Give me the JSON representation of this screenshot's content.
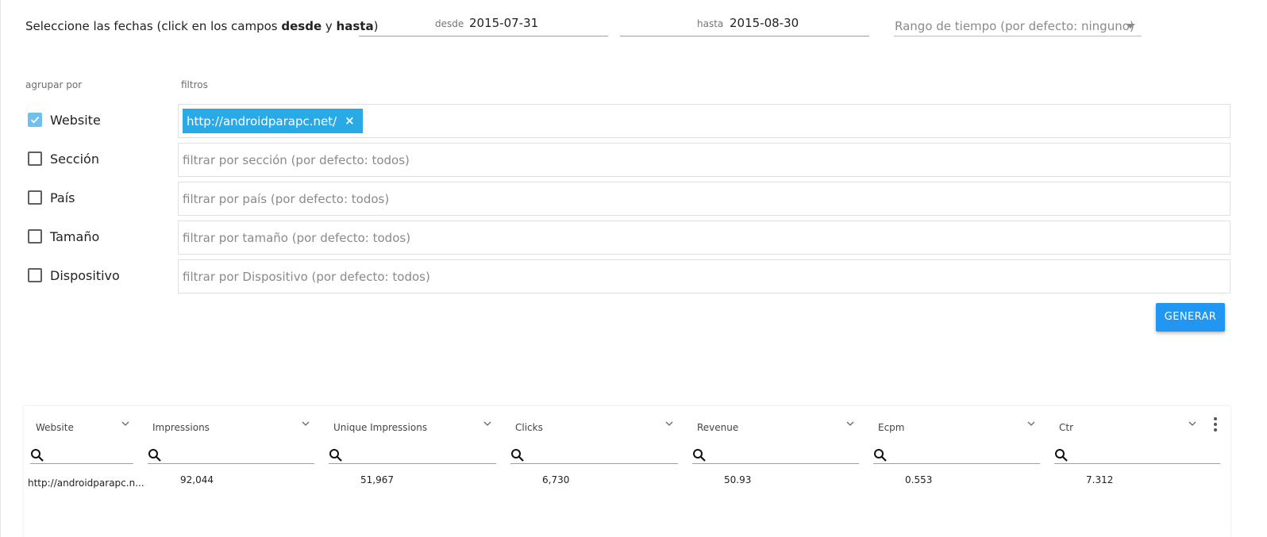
{
  "date_selection": {
    "prompt_prefix": "Seleccione las fechas (click en los campos ",
    "prompt_from_word": "desde",
    "prompt_and": " y ",
    "prompt_to_word": "hasta",
    "prompt_suffix": ")",
    "from_label": "desde",
    "from_value": "2015-07-31",
    "to_label": "hasta",
    "to_value": "2015-08-30",
    "range_placeholder": "Rango de tiempo (por defecto: ninguno)"
  },
  "group_by": {
    "heading": "agrupar por",
    "options": [
      {
        "label": "Website",
        "checked": true
      },
      {
        "label": "Sección",
        "checked": false
      },
      {
        "label": "País",
        "checked": false
      },
      {
        "label": "Tamaño",
        "checked": false
      },
      {
        "label": "Dispositivo",
        "checked": false
      }
    ]
  },
  "filters": {
    "heading": "filtros",
    "website_chip": "http://androidparapc.net/",
    "chip_remove": "×",
    "section_placeholder": "filtrar por sección (por defecto: todos)",
    "country_placeholder": "filtrar por país (por defecto: todos)",
    "size_placeholder": "filtrar por tamaño (por defecto: todos)",
    "device_placeholder": "filtrar por Dispositivo (por defecto: todos)"
  },
  "generate_button": "GENERAR",
  "grid": {
    "columns": [
      "Website",
      "Impressions",
      "Unique Impressions",
      "Clicks",
      "Revenue",
      "Ecpm",
      "Ctr"
    ],
    "rows": [
      [
        "http://androidparapc.n...",
        "92,044",
        "51,967",
        "6,730",
        "50.93",
        "0.553",
        "7.312"
      ]
    ]
  },
  "colors": {
    "accent": "#2196f3",
    "chip": "#29aae6",
    "checkbox_checked": "#6fc0ee"
  },
  "icons": [
    "checkmark-icon",
    "close-icon",
    "caret-down-icon",
    "chevron-down-icon",
    "search-icon",
    "more-vert-icon"
  ]
}
